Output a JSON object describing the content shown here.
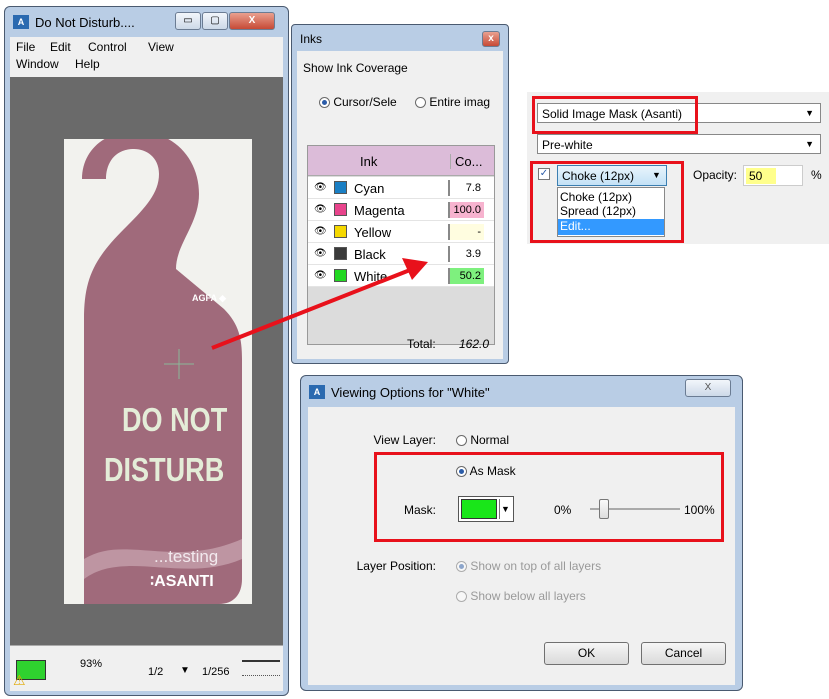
{
  "main_window": {
    "title": "Do Not Disturb....",
    "logo": "A",
    "minimize": "▭",
    "maximize": "▢",
    "close": "X",
    "menu_row1": [
      "File",
      "Edit",
      "Control",
      "View"
    ],
    "menu_row2": [
      "Window",
      "Help"
    ],
    "artwork": {
      "brand": "AGFA ◆",
      "headline1": "DO NOT",
      "headline2": "DISTURB",
      "tagline": "...testing",
      "logo_text": "∶ASANTI"
    },
    "status": {
      "zoom": "93%",
      "page": "1/2",
      "fraction": "1/256"
    }
  },
  "inks_panel": {
    "title": "Inks",
    "close": "x",
    "section": "Show Ink Coverage",
    "radio1": "Cursor/Sele",
    "radio2": "Entire imag",
    "col_ink": "Ink",
    "col_coverage": "Co...",
    "inks": [
      {
        "name": "Cyan",
        "value": "7.8",
        "color": "#1a7fc4",
        "bar": "#ffffff"
      },
      {
        "name": "Magenta",
        "value": "100.0",
        "color": "#e8448c",
        "bar": "#f7b3cf"
      },
      {
        "name": "Yellow",
        "value": "-",
        "color": "#f5d800",
        "bar": "#fffde0"
      },
      {
        "name": "Black",
        "value": "3.9",
        "color": "#3a3a3a",
        "bar": "#ffffff"
      },
      {
        "name": "White",
        "value": "50.2",
        "color": "#22d822",
        "bar": "#7ef07e"
      }
    ],
    "total_label": "Total:",
    "total_value": "162.0"
  },
  "mask_controls": {
    "mask_type": "Solid Image Mask (Asanti)",
    "prewhite": "Pre-white",
    "choke_selected": "Choke (12px)",
    "opacity_label": "Opacity:",
    "opacity_value": "50",
    "percent": "%",
    "options": [
      "Choke (12px)",
      "Spread (12px)",
      "Edit..."
    ]
  },
  "view_dialog": {
    "title": "Viewing Options for \"White\"",
    "close": "X",
    "view_layer_label": "View Layer:",
    "normal": "Normal",
    "as_mask": "As Mask",
    "mask_label": "Mask:",
    "mask_color": "#19e619",
    "slider_min": "0%",
    "slider_max": "100%",
    "slider_level": 0.15,
    "layer_position_label": "Layer Position:",
    "pos_top": "Show on top of all layers",
    "pos_below": "Show below all layers",
    "ok": "OK",
    "cancel": "Cancel"
  },
  "colors": {
    "accent_red": "#e8111b",
    "hanger": "#a06a7b",
    "headline": "#e4edd8"
  }
}
